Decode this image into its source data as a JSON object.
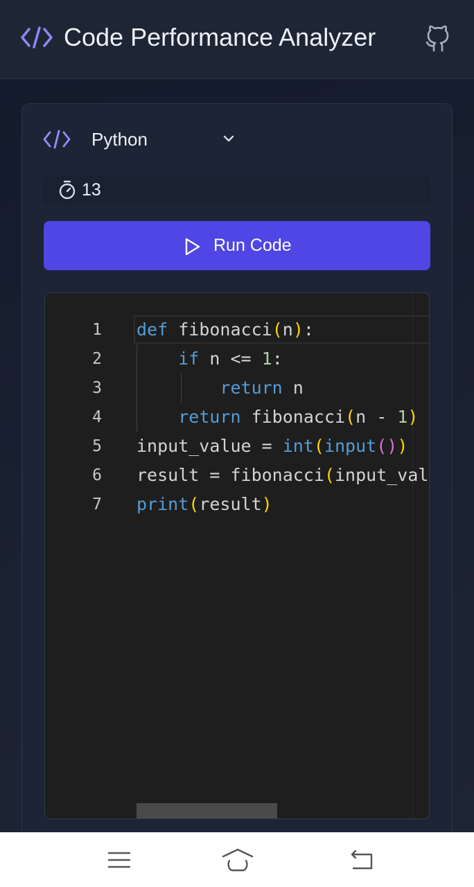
{
  "header": {
    "title": "Code Performance Analyzer",
    "logo_icon": "code-brackets-icon",
    "github_icon": "github-icon"
  },
  "language": {
    "icon": "code-brackets-icon",
    "selected": "Python"
  },
  "input": {
    "icon": "timer-icon",
    "value": "13"
  },
  "run_button": {
    "icon": "play-icon",
    "label": "Run Code"
  },
  "editor": {
    "line_numbers": [
      "1",
      "2",
      "3",
      "4",
      "5",
      "6",
      "7"
    ],
    "lines": [
      [
        {
          "t": "def",
          "c": "kw"
        },
        {
          "t": " ",
          "c": "id"
        },
        {
          "t": "fibonacci",
          "c": "id"
        },
        {
          "t": "(",
          "c": "p1"
        },
        {
          "t": "n",
          "c": "id"
        },
        {
          "t": ")",
          "c": "p1"
        },
        {
          "t": ":",
          "c": "id"
        }
      ],
      [
        {
          "t": "    ",
          "c": "id"
        },
        {
          "t": "if",
          "c": "kw"
        },
        {
          "t": " n <= ",
          "c": "id"
        },
        {
          "t": "1",
          "c": "num"
        },
        {
          "t": ":",
          "c": "id"
        }
      ],
      [
        {
          "t": "        ",
          "c": "id"
        },
        {
          "t": "return",
          "c": "kw"
        },
        {
          "t": " n",
          "c": "id"
        }
      ],
      [
        {
          "t": "    ",
          "c": "id"
        },
        {
          "t": "return",
          "c": "kw"
        },
        {
          "t": " fibonacci",
          "c": "id"
        },
        {
          "t": "(",
          "c": "p1"
        },
        {
          "t": "n - ",
          "c": "id"
        },
        {
          "t": "1",
          "c": "num"
        },
        {
          "t": ")",
          "c": "p1"
        }
      ],
      [
        {
          "t": "input_value = ",
          "c": "id"
        },
        {
          "t": "int",
          "c": "kw"
        },
        {
          "t": "(",
          "c": "p1"
        },
        {
          "t": "input",
          "c": "kw"
        },
        {
          "t": "(",
          "c": "p2"
        },
        {
          "t": ")",
          "c": "p2"
        },
        {
          "t": ")",
          "c": "p1"
        }
      ],
      [
        {
          "t": "result = fibonacci",
          "c": "id"
        },
        {
          "t": "(",
          "c": "p1"
        },
        {
          "t": "input_value",
          "c": "id"
        },
        {
          "t": ")",
          "c": "p1"
        }
      ],
      [
        {
          "t": "print",
          "c": "kw"
        },
        {
          "t": "(",
          "c": "p1"
        },
        {
          "t": "result",
          "c": "id"
        },
        {
          "t": ")",
          "c": "p1"
        }
      ]
    ]
  },
  "colors": {
    "accent": "#4f46e5",
    "logo": "#8b8bf5",
    "header_bg": "#1e2636",
    "editor_bg": "#1e1e1e"
  },
  "nav": {
    "recents_icon": "menu-lines-icon",
    "home_icon": "home-icon",
    "back_icon": "back-icon"
  }
}
